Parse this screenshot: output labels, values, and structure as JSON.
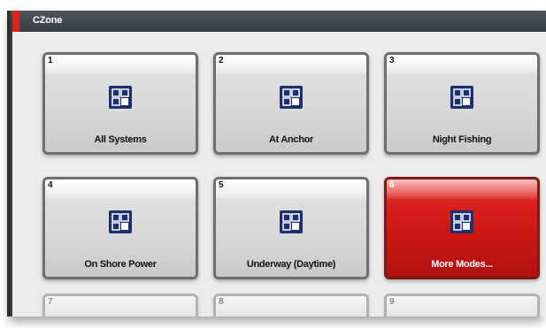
{
  "app": {
    "title": "CZone"
  },
  "colors": {
    "accent": "#e0221f",
    "titlebar": "#3f454d",
    "active_tile": "#c91712"
  },
  "modes": [
    {
      "number": "1",
      "label": "All Systems",
      "icon": "grid-modes-icon",
      "active": false
    },
    {
      "number": "2",
      "label": "At Anchor",
      "icon": "grid-modes-icon",
      "active": false
    },
    {
      "number": "3",
      "label": "Night Fishing",
      "icon": "grid-modes-icon",
      "active": false
    },
    {
      "number": "4",
      "label": "On Shore Power",
      "icon": "grid-modes-icon",
      "active": false
    },
    {
      "number": "5",
      "label": "Underway (Daytime)",
      "icon": "grid-modes-icon",
      "active": false
    },
    {
      "number": "6",
      "label": "More Modes...",
      "icon": "grid-modes-icon",
      "active": true
    },
    {
      "number": "7",
      "label": "",
      "icon": "",
      "active": false
    },
    {
      "number": "8",
      "label": "",
      "icon": "",
      "active": false
    },
    {
      "number": "9",
      "label": "",
      "icon": "",
      "active": false
    }
  ]
}
